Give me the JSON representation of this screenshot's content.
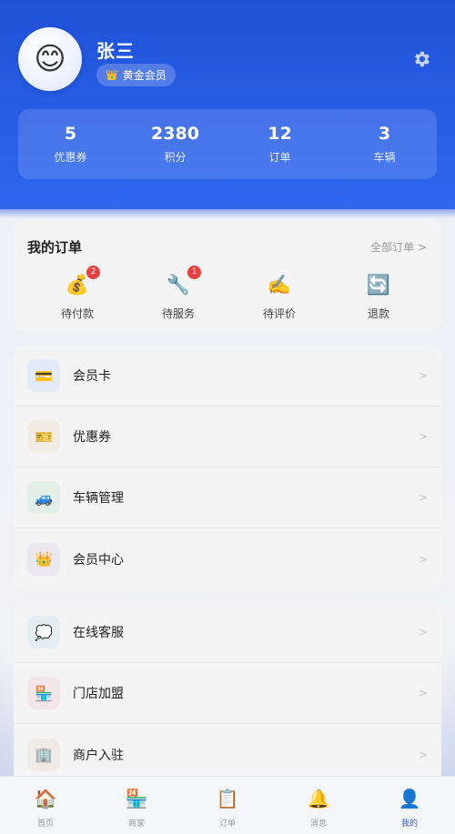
{
  "profile": {
    "name": "张三",
    "membership": "黄金会员"
  },
  "stats": [
    {
      "value": "5",
      "label": "优惠券"
    },
    {
      "value": "2380",
      "label": "积分"
    },
    {
      "value": "12",
      "label": "订单"
    },
    {
      "value": "3",
      "label": "车辆"
    }
  ],
  "orders": {
    "title": "我的订单",
    "all_label": "全部订单 >",
    "items": [
      {
        "label": "待付款",
        "icon": "money-bag-icon",
        "badge": "2"
      },
      {
        "label": "待服务",
        "icon": "wrench-icon",
        "badge": "1"
      },
      {
        "label": "待评价",
        "icon": "writing-icon",
        "badge": ""
      },
      {
        "label": "退款",
        "icon": "refund-icon",
        "badge": ""
      }
    ]
  },
  "menu1": [
    {
      "label": "会员卡",
      "icon": "card-icon"
    },
    {
      "label": "优惠券",
      "icon": "ticket-icon"
    },
    {
      "label": "车辆管理",
      "icon": "car-icon"
    },
    {
      "label": "会员中心",
      "icon": "crown-icon"
    }
  ],
  "menu2": [
    {
      "label": "在线客服",
      "icon": "chat-icon"
    },
    {
      "label": "门店加盟",
      "icon": "store-icon"
    },
    {
      "label": "商户入驻",
      "icon": "building-icon"
    }
  ],
  "arrow": ">",
  "tabs": [
    {
      "label": "首页",
      "icon": "home-icon"
    },
    {
      "label": "商家",
      "icon": "shop-icon"
    },
    {
      "label": "订单",
      "icon": "clipboard-icon"
    },
    {
      "label": "消息",
      "icon": "bell-icon"
    },
    {
      "label": "我的",
      "icon": "user-icon"
    }
  ],
  "colors": {
    "brand": "#2e5fe6",
    "badge": "#ea3f3f"
  }
}
